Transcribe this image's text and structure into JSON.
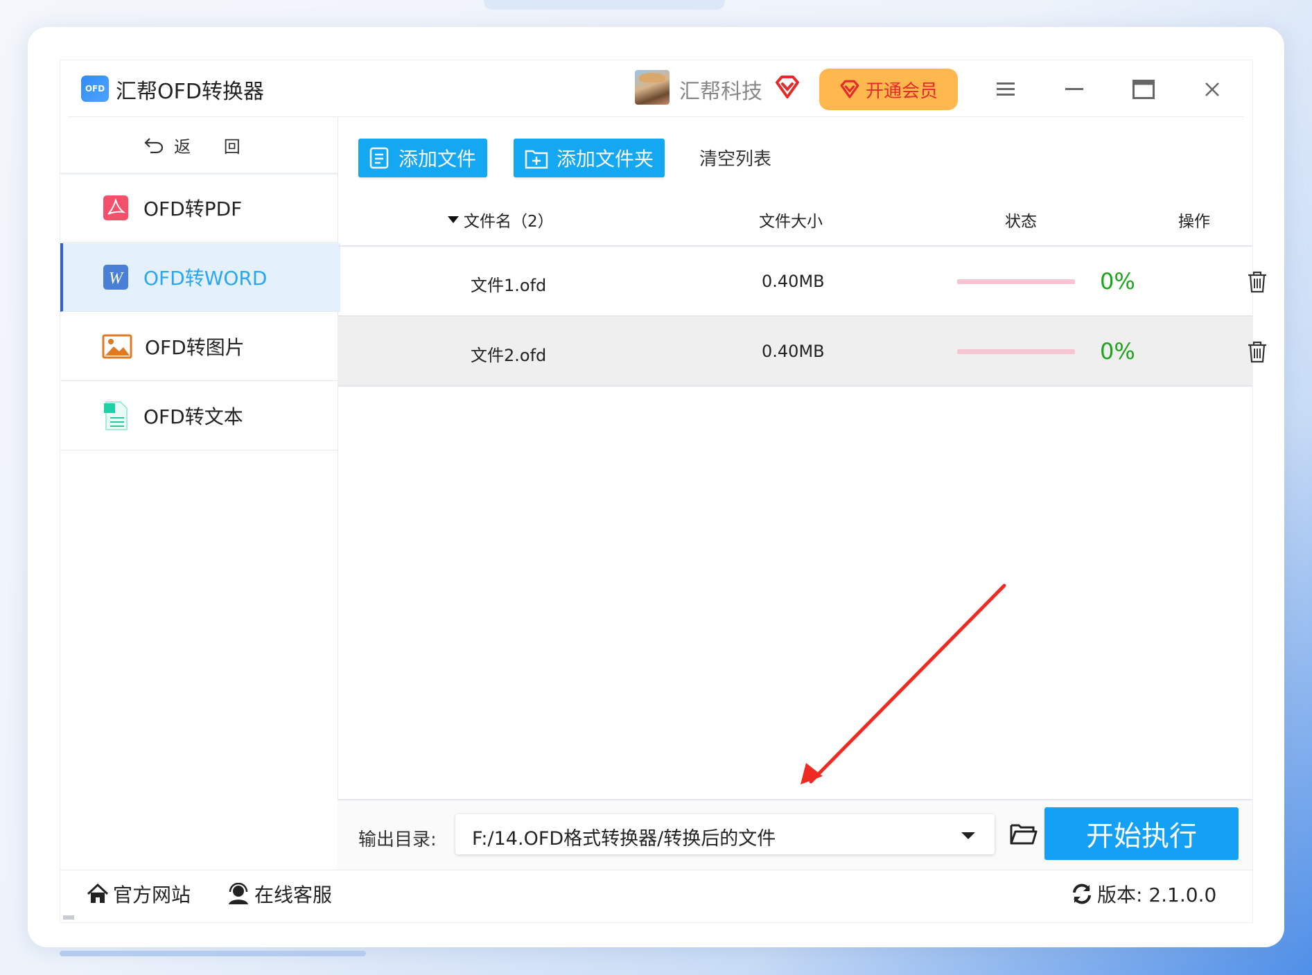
{
  "app": {
    "logo_text": "OFD",
    "title": "汇帮OFD转换器",
    "company": "汇帮科技",
    "vip_label": "开通会员",
    "brand_color": "#14a8f2",
    "vip_color": "#ffb84d"
  },
  "sidebar": {
    "back_label": "返 回",
    "items": [
      {
        "label": "OFD转PDF",
        "icon": "pdf-icon"
      },
      {
        "label": "OFD转WORD",
        "icon": "word-icon",
        "active": true
      },
      {
        "label": "OFD转图片",
        "icon": "image-icon"
      },
      {
        "label": "OFD转文本",
        "icon": "text-doc-icon"
      }
    ]
  },
  "toolbar": {
    "add_file": "添加文件",
    "add_folder": "添加文件夹",
    "clear_list": "清空列表"
  },
  "table": {
    "headers": {
      "name": "文件名（2）",
      "size": "文件大小",
      "status": "状态",
      "action": "操作"
    },
    "rows": [
      {
        "name": "文件1.ofd",
        "size": "0.40MB",
        "progress": "0%",
        "progress_value": 0
      },
      {
        "name": "文件2.ofd",
        "size": "0.40MB",
        "progress": "0%",
        "progress_value": 0
      }
    ]
  },
  "output": {
    "label": "输出目录:",
    "path": "F:/14.OFD格式转换器/转换后的文件",
    "start_label": "开始执行"
  },
  "footer": {
    "website": "官方网站",
    "support": "在线客服",
    "version": "版本: 2.1.0.0"
  }
}
